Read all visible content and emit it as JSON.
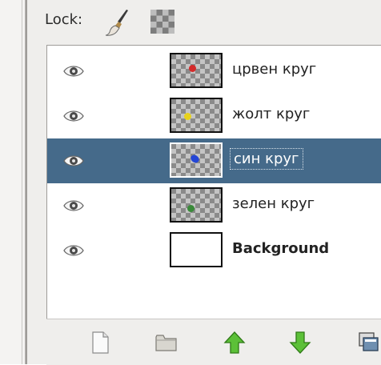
{
  "lock": {
    "label": "Lock:"
  },
  "layers": [
    {
      "name": "црвен круг",
      "dot_color": "#d42a2a",
      "selected": false,
      "visible": true
    },
    {
      "name": "жолт круг",
      "dot_color": "#e8d21a",
      "selected": false,
      "visible": true
    },
    {
      "name": "син круг",
      "dot_color": "#2446d6",
      "selected": true,
      "visible": true
    },
    {
      "name": "зелен круг",
      "dot_color": "#3a8a3a",
      "selected": false,
      "visible": true
    },
    {
      "name": "Background",
      "dot_color": "",
      "selected": false,
      "visible": true
    }
  ],
  "toolbar": {
    "icons": [
      "new-layer-icon",
      "new-group-icon",
      "raise-layer-icon",
      "lower-layer-icon",
      "duplicate-layer-icon"
    ]
  },
  "colors": {
    "selection": "#456a8a",
    "arrow_green": "#4fb22c"
  }
}
